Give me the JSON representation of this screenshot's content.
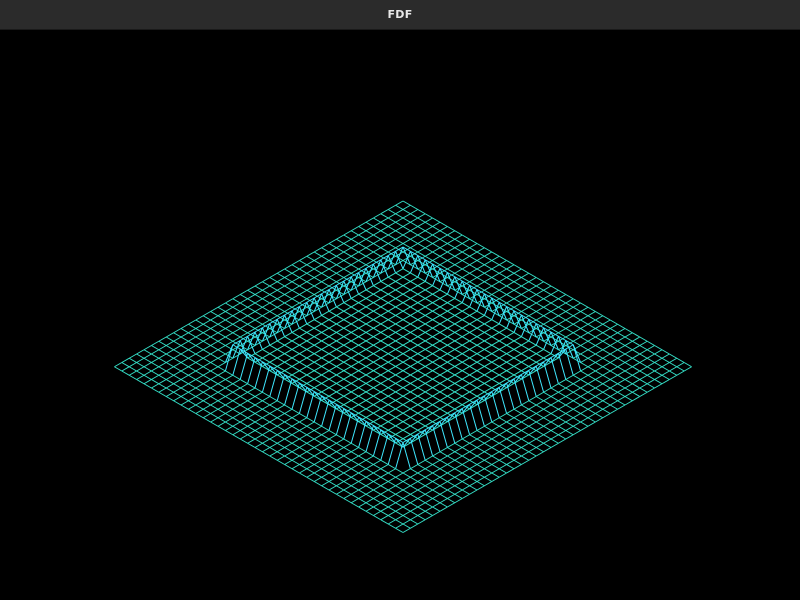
{
  "window": {
    "title": "FDF"
  },
  "scene": {
    "background": "#000000",
    "colors": {
      "low": "#35e0c8",
      "wall": "#2a2cf0",
      "rim": "#3fe8ff"
    },
    "grid": {
      "rows": 40,
      "cols": 40,
      "inner_ring_start": 8,
      "inner_ring_end": 31,
      "rim_height": 10,
      "wall_height": 4
    }
  }
}
